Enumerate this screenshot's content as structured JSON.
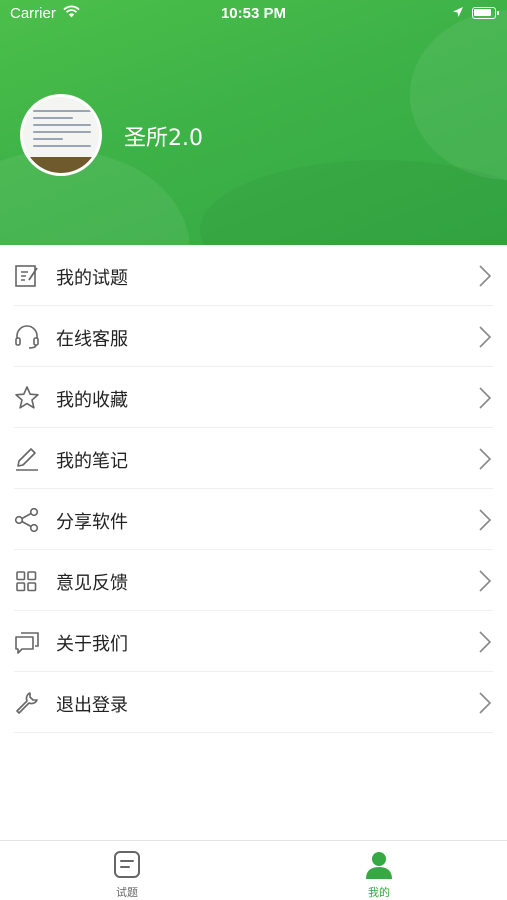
{
  "status_bar": {
    "carrier": "Carrier",
    "time": "10:53 PM"
  },
  "profile": {
    "username": "圣所2.0"
  },
  "menu": [
    {
      "label": "我的试题",
      "icon": "edit-icon"
    },
    {
      "label": "在线客服",
      "icon": "headset-icon"
    },
    {
      "label": "我的收藏",
      "icon": "star-icon"
    },
    {
      "label": "我的笔记",
      "icon": "pen-icon"
    },
    {
      "label": "分享软件",
      "icon": "share-icon"
    },
    {
      "label": "意见反馈",
      "icon": "grid-icon"
    },
    {
      "label": "关于我们",
      "icon": "chat-icon"
    },
    {
      "label": "退出登录",
      "icon": "wrench-icon"
    }
  ],
  "tabs": [
    {
      "label": "试题",
      "icon": "document-icon",
      "active": false
    },
    {
      "label": "我的",
      "icon": "person-icon",
      "active": true
    }
  ],
  "colors": {
    "accent": "#35a944",
    "text": "#222222",
    "inactive": "#666666"
  }
}
